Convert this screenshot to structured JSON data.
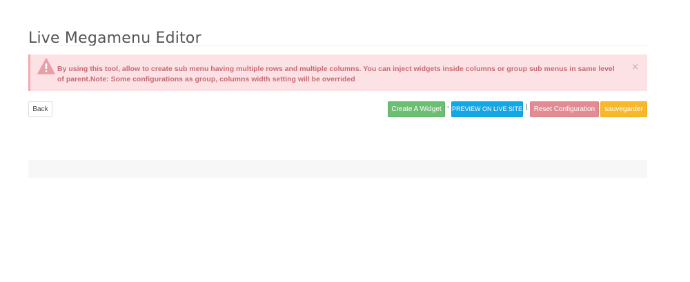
{
  "page": {
    "title": "Live Megamenu Editor"
  },
  "alert": {
    "icon": "warning-triangle-icon",
    "message": "By using this tool, allow to create sub menu having multiple rows and multiple columns. You can inject widgets inside columns or group sub menus in same level of parent.Note: Some configurations as group, columns width setting will be overrided",
    "close": "×",
    "colors": {
      "background": "#fde2e5",
      "text": "#c66a73"
    }
  },
  "toolbar": {
    "back_label": "Back",
    "create_widget_label": "Create A Widget",
    "separator_dash": "-",
    "preview_label": "PREVIEW ON LIVE SITE",
    "separator_bar": "|",
    "reset_label": "Reset Configuration",
    "save_label": "sauvegarder",
    "colors": {
      "create": "#6cbf72",
      "preview": "#14a7e6",
      "reset": "#e38b93",
      "save": "#f7b82a"
    }
  }
}
